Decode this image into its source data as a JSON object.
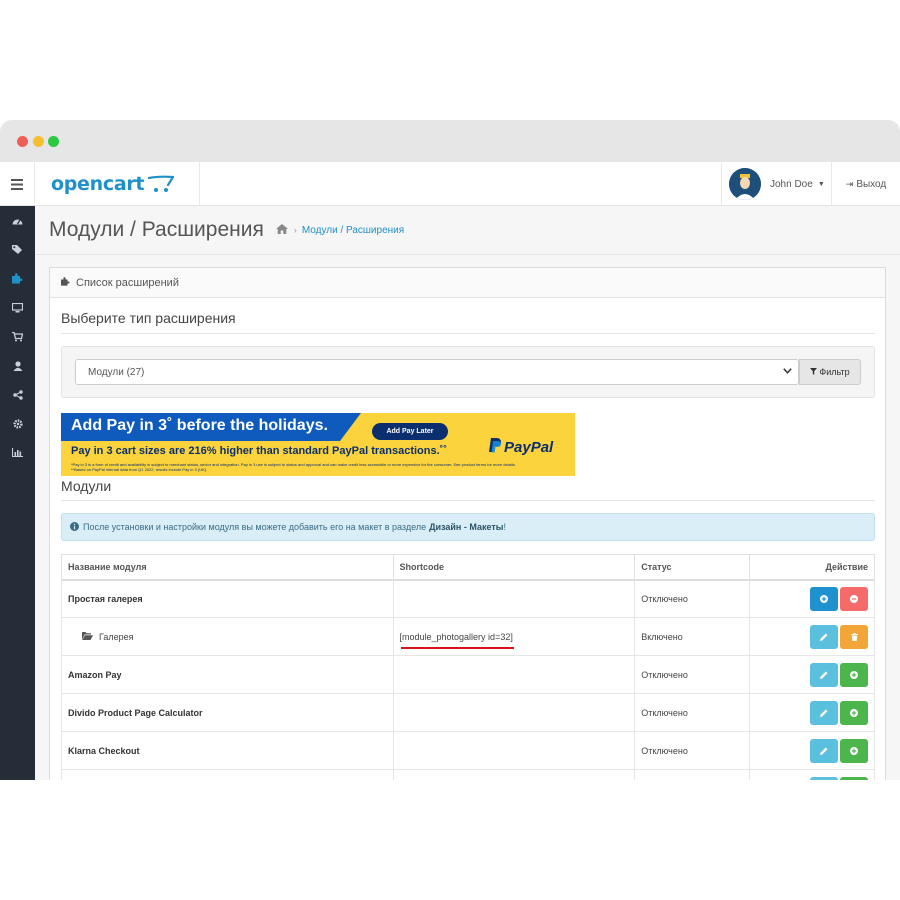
{
  "header": {
    "logo_text": "opencart",
    "user_name": "John Doe",
    "logout_label": "Выход"
  },
  "sidebar": {
    "items": [
      {
        "icon": "dashboard-icon"
      },
      {
        "icon": "tags-icon"
      },
      {
        "icon": "puzzle-icon",
        "active": true
      },
      {
        "icon": "desktop-icon"
      },
      {
        "icon": "cart-icon"
      },
      {
        "icon": "user-icon"
      },
      {
        "icon": "share-icon"
      },
      {
        "icon": "cog-icon"
      },
      {
        "icon": "bar-chart-icon"
      }
    ]
  },
  "page": {
    "title": "Модули / Расширения",
    "breadcrumb_link": "Модули / Расширения"
  },
  "panel": {
    "heading": "Список расширений",
    "section_title": "Выберите тип расширения",
    "select_value": "Модули (27)",
    "filter_label": "Фильтр",
    "modules_title": "Модули"
  },
  "banner": {
    "headline": "Add Pay in 3˚ before the holidays.",
    "cta": "Add Pay Later",
    "subline": "Pay in 3 cart sizes are 216% higher than standard PayPal transactions.˚˚",
    "fine_print_1": "*Pay in 3 is a form of credit and availability is subject to merchant status, sector and integration. Pay in 3 use is subject to status and approval and can make credit less accessible or more expensive for the consumer. See product terms for more details.",
    "fine_print_2": "**Based on PayPal internal data from Q1 2022, results include Pay in 3 (UK).",
    "brand": "PayPal"
  },
  "info": {
    "text": "После установки и настройки модуля вы можете добавить его на макет в разделе",
    "bold": "Дизайн - Макеты",
    "tail": "!"
  },
  "table": {
    "headers": [
      "Название модуля",
      "Shortcode",
      "Статус",
      "Действие"
    ],
    "rows": [
      {
        "name": "Простая галерея",
        "shortcode": "",
        "status": "Отключено"
      },
      {
        "name": "Галерея",
        "shortcode": "[module_photogallery id=32]",
        "status": "Включено"
      },
      {
        "name": "Amazon Pay",
        "shortcode": "",
        "status": "Отключено"
      },
      {
        "name": "Divido Product Page Calculator",
        "shortcode": "",
        "status": "Отключено"
      },
      {
        "name": "Klarna Checkout",
        "shortcode": "",
        "status": "Отключено"
      },
      {
        "name": "",
        "shortcode": "",
        "status": ""
      }
    ]
  },
  "colors": {
    "brand": "#1f90c8",
    "sidebar": "#252e38",
    "primary": "#1e91cf",
    "danger": "#f56b6b",
    "info": "#5bc0de",
    "warning": "#f3a638",
    "success": "#4cb64c",
    "highlight_underline": "#d8131a"
  }
}
